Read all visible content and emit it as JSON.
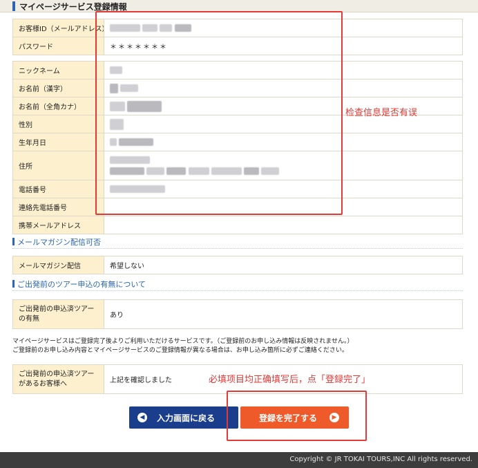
{
  "header": {
    "title": "マイページサービス登録情報"
  },
  "account": {
    "rows": [
      {
        "label": "お客様ID（メールアドレス）",
        "value": ""
      },
      {
        "label": "パスワード",
        "value": "＊＊＊＊＊＊＊"
      }
    ]
  },
  "profile": {
    "rows": [
      {
        "label": "ニックネーム"
      },
      {
        "label": "お名前（漢字）"
      },
      {
        "label": "お名前（全角カナ）"
      },
      {
        "label": "性別"
      },
      {
        "label": "生年月日"
      },
      {
        "label": "住所"
      },
      {
        "label": "電話番号"
      },
      {
        "label": "連絡先電話番号"
      },
      {
        "label": "携帯メールアドレス"
      }
    ]
  },
  "magazine": {
    "section_title": "メールマガジン配信可否",
    "label": "メールマガジン配信",
    "value": "希望しない"
  },
  "pretour": {
    "section_title": "ご出発前のツアー申込の有無について",
    "label": "ご出発前の申込済ツアーの有無",
    "value": "あり"
  },
  "notice": {
    "line1": "マイページサービスはご登録完了後よりご利用いただけるサービスです。（ご登録前のお申し込み情報は反映されません。）",
    "line2": "ご登録前のお申し込み内容とマイページサービスのご登録情報が異なる場合は、お申し込み箇所に必ずご連絡ください。"
  },
  "confirm": {
    "label": "ご出発前の申込済ツアーがあるお客様へ",
    "value": "上記を確認しました"
  },
  "buttons": {
    "back_label": "入力画面に戻る",
    "done_label": "登録を完了する"
  },
  "annotations": {
    "check_info": "检查信息是否有误",
    "complete_instruction": "必填项目均正确填写后，点「登録完了」",
    "color": "#e53935"
  },
  "footer": {
    "copyright": "Copyright © JR TOKAI TOURS,INC All rights reserved."
  },
  "icons": {
    "back": "chevron-left-icon",
    "forward": "chevron-right-icon"
  }
}
